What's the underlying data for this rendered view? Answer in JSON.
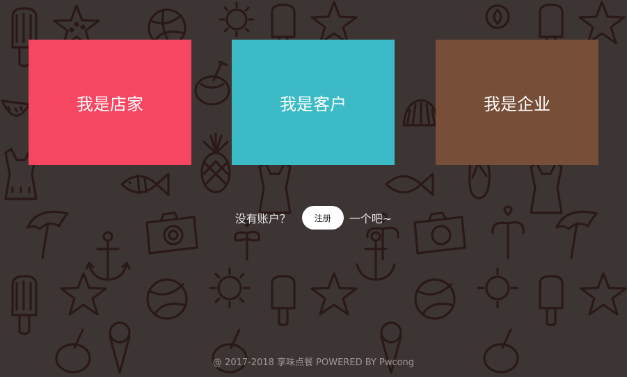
{
  "colors": {
    "background": "#3d3534",
    "doodle_stroke": "#2a1717",
    "shop_card": "#f64662",
    "customer_card": "#3cbbc7",
    "company_card": "#774f38",
    "register_button_bg": "#ffffff"
  },
  "roles": {
    "shop": {
      "label": "我是店家",
      "color": "#f64662"
    },
    "customer": {
      "label": "我是客户",
      "color": "#3cbbc7"
    },
    "company": {
      "label": "我是企业",
      "color": "#774f38"
    }
  },
  "register": {
    "prefix": "没有账户？",
    "button_label": "注册",
    "suffix": "一个吧~"
  },
  "footer": {
    "text": "@ 2017-2018 享味点餐 POWERED BY Pwcong"
  },
  "background_icons": [
    "popsicle-icon",
    "starfish-icon",
    "beach-ball-icon",
    "sun-icon",
    "watermelon-icon",
    "coconut-drink-icon",
    "pineapple-icon",
    "fish-icon",
    "umbrella-icon",
    "camera-icon",
    "anchor-icon",
    "leaf-icon",
    "shell-icon",
    "ice-cream-icon",
    "flip-flop-icon",
    "swimsuit-icon"
  ]
}
